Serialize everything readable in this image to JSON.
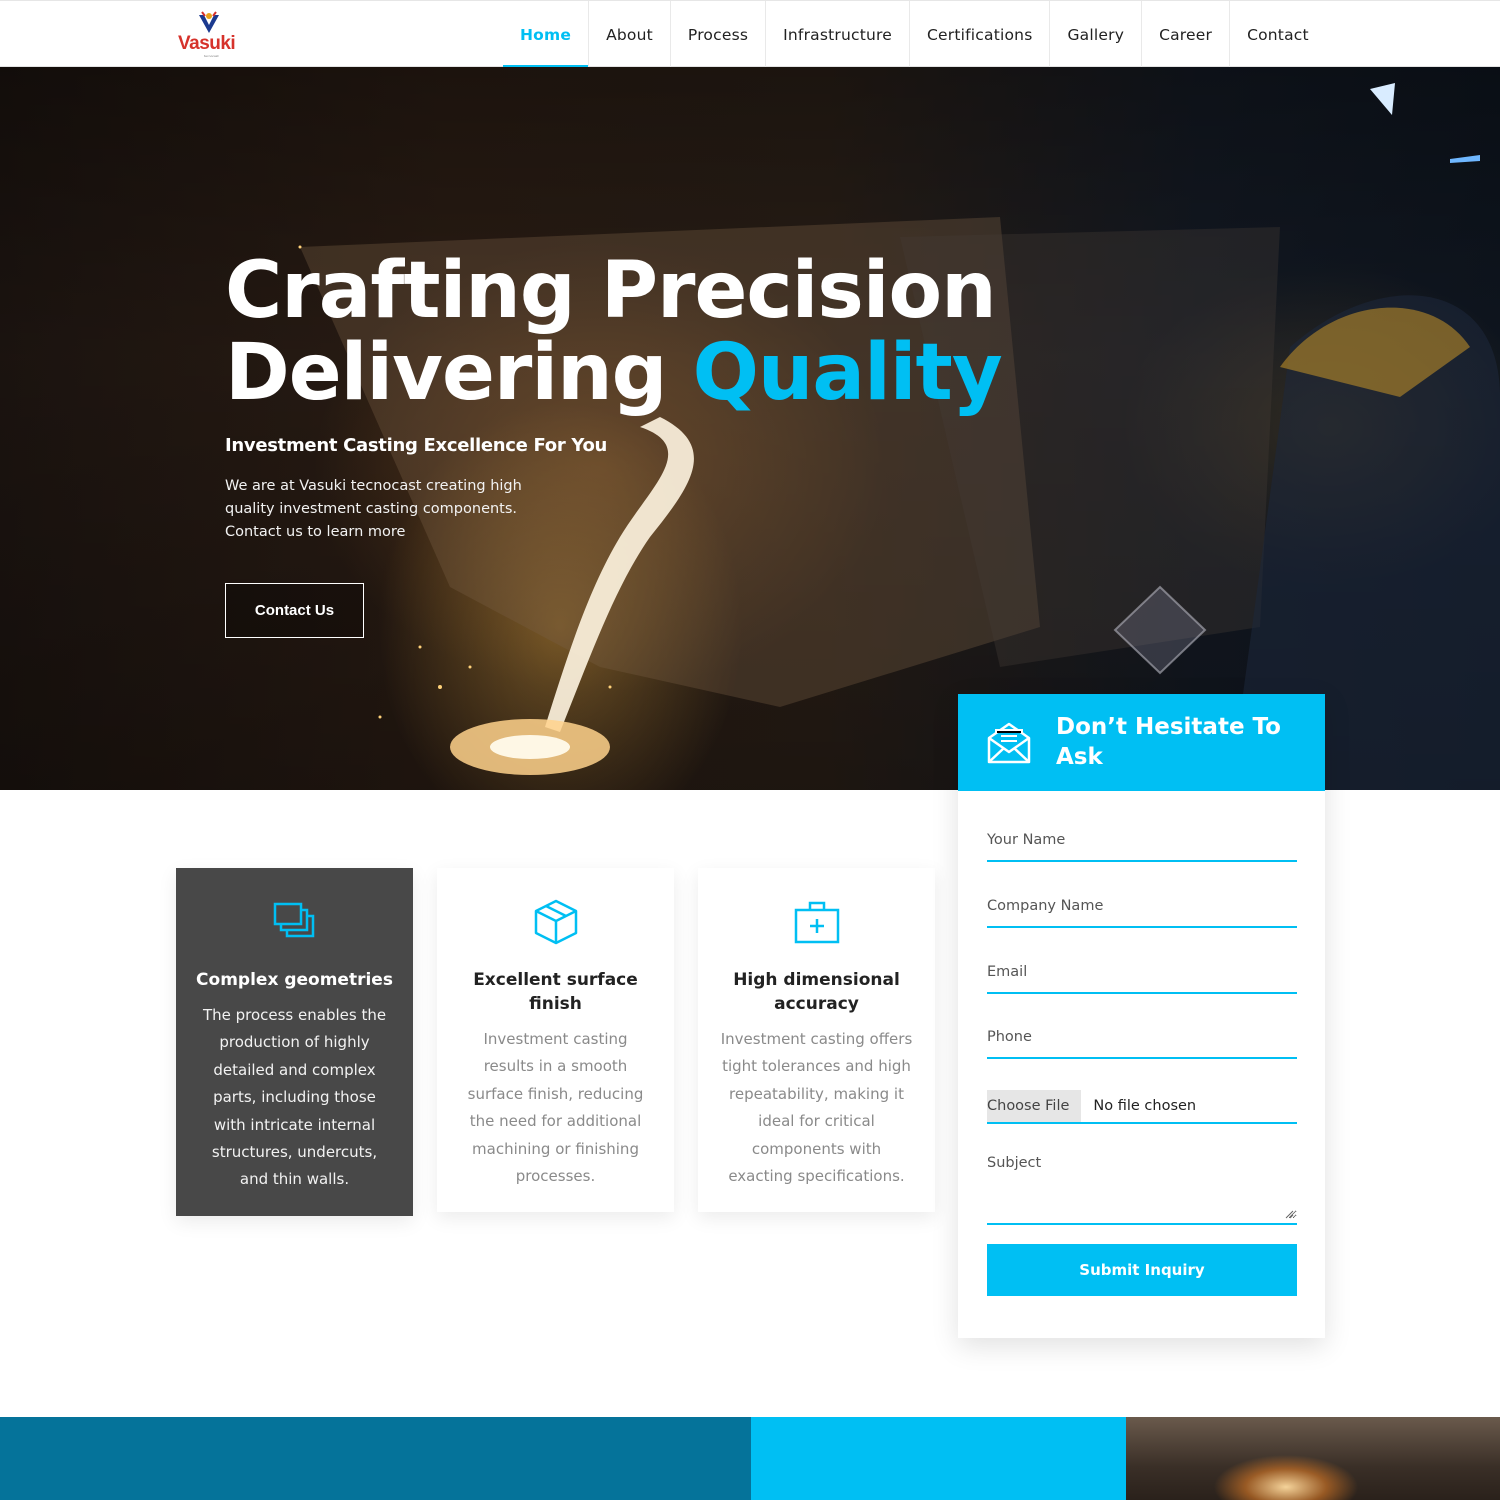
{
  "brand": {
    "name": "Vasuki",
    "sub": "tecnocast",
    "primary_color": "#00bff3",
    "logo_color": "#d6322b"
  },
  "nav": {
    "items": [
      {
        "label": "Home",
        "active": true
      },
      {
        "label": "About"
      },
      {
        "label": "Process"
      },
      {
        "label": "Infrastructure"
      },
      {
        "label": "Certifications"
      },
      {
        "label": "Gallery"
      },
      {
        "label": "Career"
      },
      {
        "label": "Contact"
      }
    ]
  },
  "hero": {
    "title_line1": "Crafting Precision",
    "title_line2_plain": "Delivering ",
    "title_line2_accent": "Quality",
    "subtitle": "Investment Casting Excellence For You",
    "description": "We are at Vasuki tecnocast creating high quality investment casting components. Contact us to learn more",
    "button_label": "Contact Us"
  },
  "features": [
    {
      "icon": "layers-icon",
      "title": "Complex geometries",
      "text": "The process enables the production of highly detailed and complex parts, including those with intricate internal structures, undercuts, and thin walls."
    },
    {
      "icon": "cube-icon",
      "title": "Excellent surface finish",
      "text": "Investment casting results in a smooth surface finish, reducing the need for additional machining or finishing processes."
    },
    {
      "icon": "medical-case-icon",
      "title": "High dimensional accuracy",
      "text": "Investment casting offers tight tolerances and high repeatability, making it ideal for critical components with exacting specifications."
    }
  ],
  "inquiry": {
    "title": "Don’t Hesitate To Ask",
    "icon": "envelope-icon",
    "name_placeholder": "Your Name",
    "company_placeholder": "Company Name",
    "email_placeholder": "Email",
    "phone_placeholder": "Phone",
    "file_button": "Choose File",
    "file_status": "No file chosen",
    "subject_placeholder": "Subject",
    "submit_label": "Submit Inquiry"
  }
}
